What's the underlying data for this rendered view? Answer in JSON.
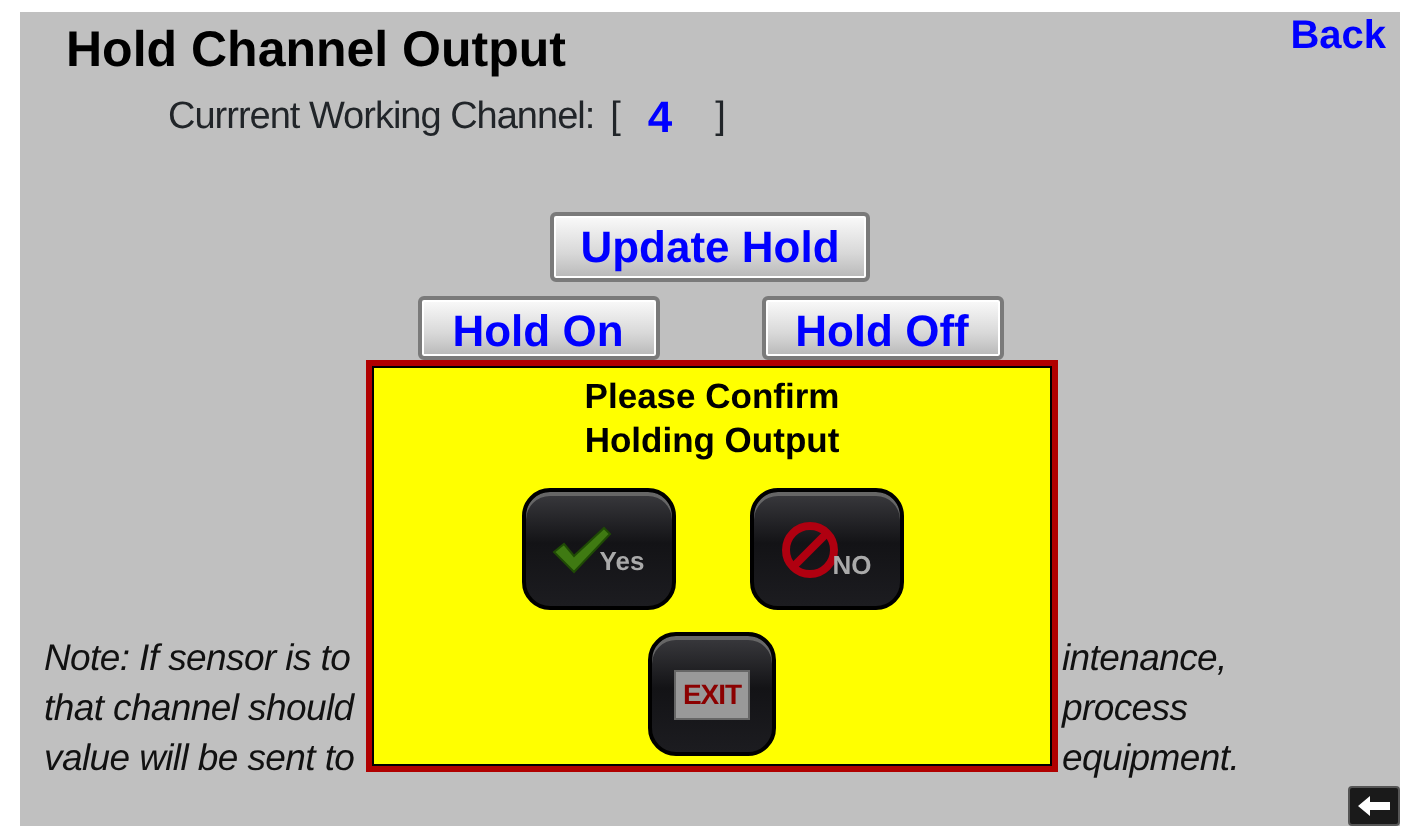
{
  "header": {
    "title": "Hold Channel Output",
    "back": "Back"
  },
  "channel": {
    "label": "Currrent Working Channel:",
    "open": "[",
    "value": "4",
    "close": "]"
  },
  "update_button": "Update Hold",
  "hold_buttons": [
    "Hold On",
    "Hold Off"
  ],
  "note": [
    {
      "kind": "split",
      "left": "Note: If sensor is to",
      "right": "intenance,"
    },
    {
      "kind": "split",
      "left": "that channel should",
      "right": "process"
    },
    {
      "kind": "split",
      "left": "value will be sent to",
      "right": "equipment."
    }
  ],
  "dialog": {
    "title": [
      "Please Confirm",
      "Holding Output"
    ],
    "buttons": [
      {
        "kind": "yes",
        "label": "Yes"
      },
      {
        "kind": "no",
        "label": "NO"
      },
      {
        "kind": "exit",
        "label": "EXIT"
      }
    ]
  }
}
